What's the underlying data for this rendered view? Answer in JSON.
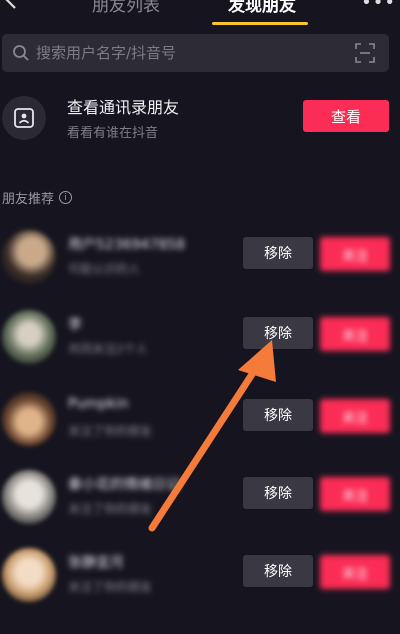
{
  "header": {
    "tabs": [
      {
        "label": "朋友列表",
        "active": false
      },
      {
        "label": "发现朋友",
        "active": true
      }
    ],
    "more_label": "•••",
    "accent_color": "#f7c531"
  },
  "search": {
    "placeholder": "搜索用户名字/抖音号"
  },
  "contacts": {
    "title": "查看通讯录朋友",
    "subtitle": "看看有谁在抖音",
    "button_label": "查看"
  },
  "recommendations": {
    "section_title": "朋友推荐",
    "info_icon": "ⓘ",
    "items": [
      {
        "name": "用户5236947858",
        "reason": "可能认识的人",
        "remove_label": "移除",
        "follow_label": "关注"
      },
      {
        "name": "李",
        "reason": "共同关注2个人",
        "remove_label": "移除",
        "follow_label": "关注"
      },
      {
        "name": "Pumpkin",
        "reason": "关注了你的朋友",
        "remove_label": "移除",
        "follow_label": "关注"
      },
      {
        "name": "秦小花的情绪日记",
        "reason": "关注了你的朋友",
        "remove_label": "移除",
        "follow_label": "关注"
      },
      {
        "name": "张静宜月",
        "reason": "关注了你的朋友",
        "remove_label": "移除",
        "follow_label": "关注"
      }
    ]
  },
  "colors": {
    "background": "#16151f",
    "primary_red": "#fb2c55",
    "secondary_button": "#393843",
    "annotation_arrow": "#f47b3a"
  }
}
